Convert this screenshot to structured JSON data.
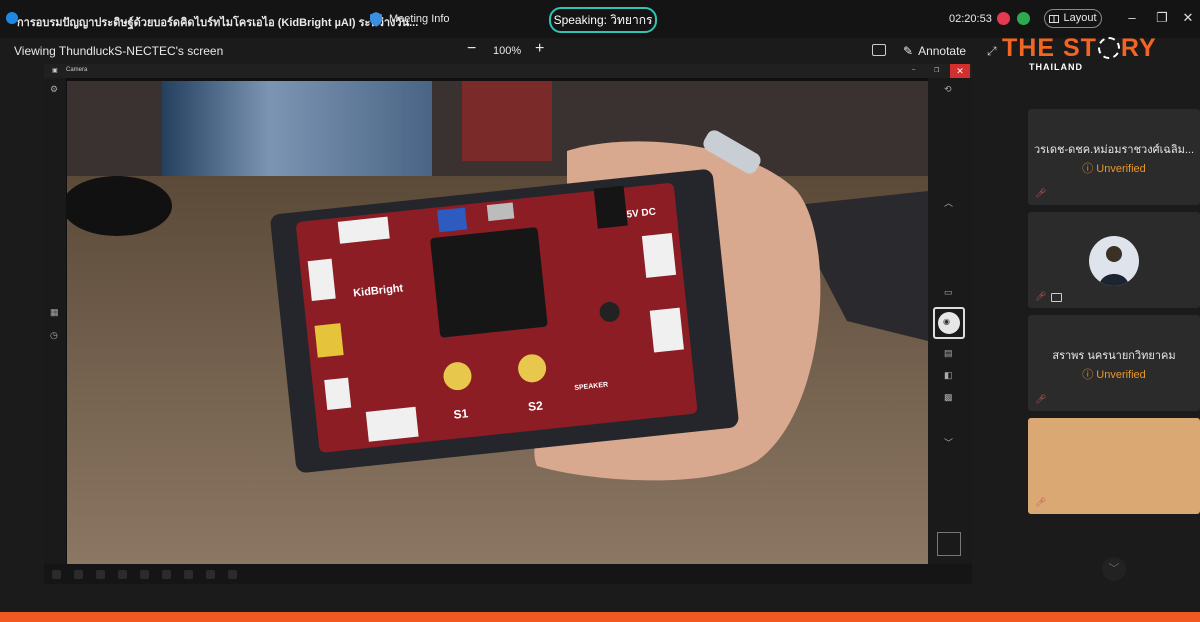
{
  "titlebar": {
    "meeting_title": "การอบรมปัญญาประดิษฐ์ด้วยบอร์ดคิดไบร์ทไมโครเอไอ (KidBright µAI) ระหว่างวัน...",
    "meeting_info": "Meeting Info",
    "speaking": "Speaking: วิทยากร",
    "clock": "02:20:53",
    "layout_label": "Layout"
  },
  "toolbar": {
    "viewing": "Viewing ThundluckS-NECTEC's screen",
    "zoom": "100%",
    "annotate": "Annotate"
  },
  "logo": {
    "main_left": "THE ST",
    "main_right": "RY",
    "sub": "THAILAND"
  },
  "shared_screen": {
    "window_title": "Camera"
  },
  "participants": [
    {
      "name": "วรเดช-ดชค.หม่อมราชวงศ์เฉลิม...",
      "status": "Unverified"
    },
    {
      "name": "",
      "status": ""
    },
    {
      "name": "สราพร นครนายกวิทยาคม",
      "status": "Unverified"
    },
    {
      "name": "",
      "status": ""
    }
  ],
  "board": {
    "name": "KidBright",
    "s1": "S1",
    "s2": "S2",
    "power": "5V DC",
    "speaker": "SPEAKER"
  },
  "colors": {
    "accent_speaking": "#2ec4b6",
    "unverified": "#e8962e",
    "brand_orange": "#f05a22",
    "board_red": "#8c1d24"
  }
}
